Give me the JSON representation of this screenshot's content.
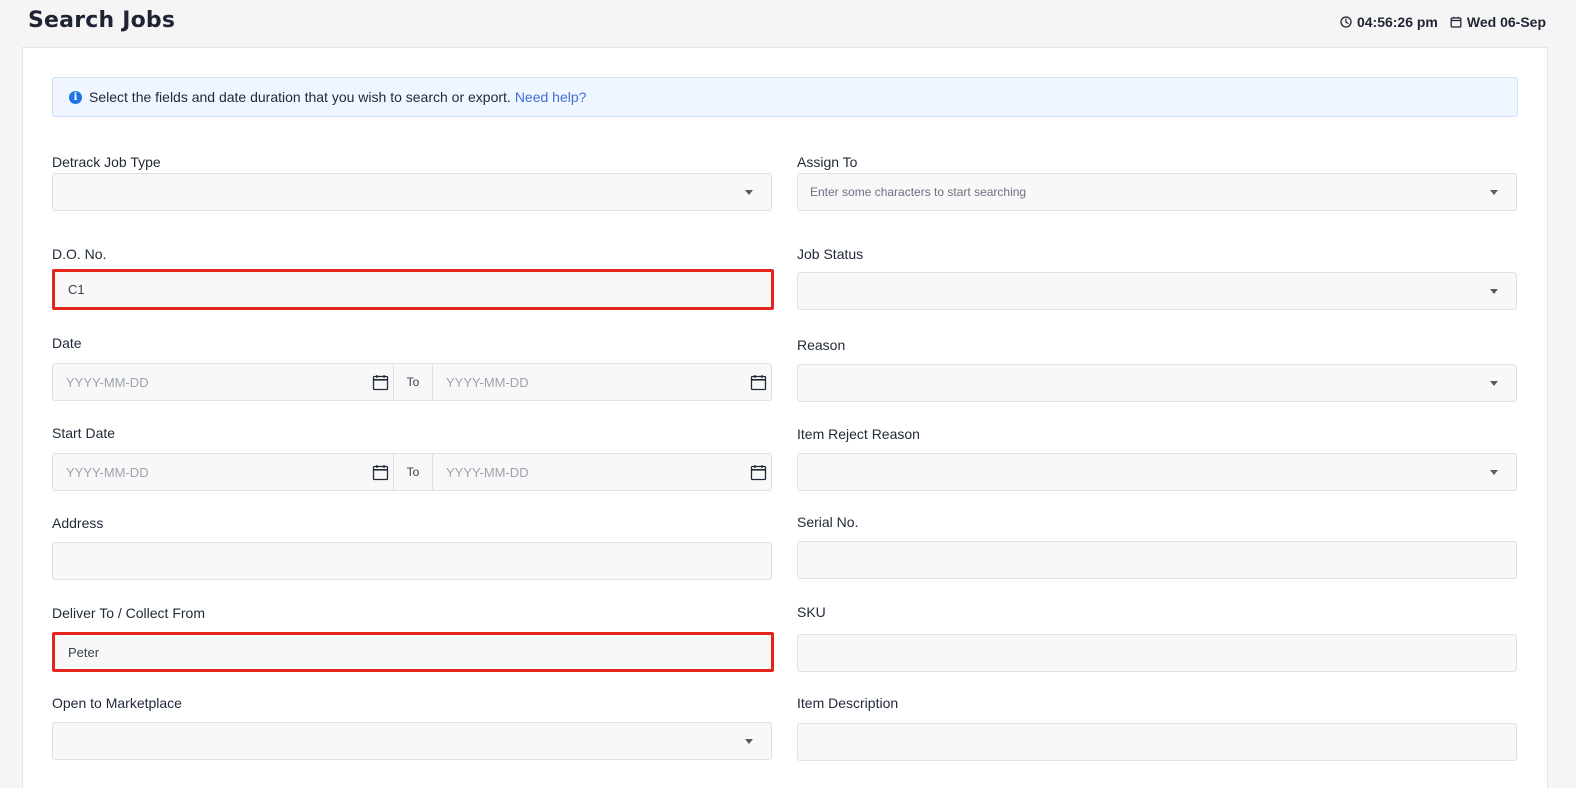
{
  "header": {
    "title": "Search Jobs",
    "time": "04:56:26 pm",
    "date": "Wed 06-Sep"
  },
  "info": {
    "message": "Select the fields and date duration that you wish to search or export.",
    "help_link": "Need help?"
  },
  "left": {
    "job_type": {
      "label": "Detrack Job Type",
      "value": ""
    },
    "do_no": {
      "label": "D.O. No.",
      "value": "C1"
    },
    "date": {
      "label": "Date",
      "from_placeholder": "YYYY-MM-DD",
      "to_label": "To",
      "to_placeholder": "YYYY-MM-DD"
    },
    "start_date": {
      "label": "Start Date",
      "from_placeholder": "YYYY-MM-DD",
      "to_label": "To",
      "to_placeholder": "YYYY-MM-DD"
    },
    "address": {
      "label": "Address",
      "value": ""
    },
    "deliver_to": {
      "label": "Deliver To / Collect From",
      "value": "Peter"
    },
    "marketplace": {
      "label": "Open to Marketplace",
      "value": ""
    }
  },
  "right": {
    "assign_to": {
      "label": "Assign To",
      "placeholder": "Enter some characters to start searching"
    },
    "job_status": {
      "label": "Job Status",
      "value": ""
    },
    "reason": {
      "label": "Reason",
      "value": ""
    },
    "item_reject_reason": {
      "label": "Item Reject Reason",
      "value": ""
    },
    "serial_no": {
      "label": "Serial No.",
      "value": ""
    },
    "sku": {
      "label": "SKU",
      "value": ""
    },
    "item_description": {
      "label": "Item Description",
      "value": ""
    }
  },
  "colors": {
    "highlight": "#e2261c",
    "link": "#3f6fd8",
    "info_icon": "#1e74e6"
  },
  "icons": [
    "clock-icon",
    "calendar-icon",
    "info-icon",
    "chevron-down-icon"
  ]
}
